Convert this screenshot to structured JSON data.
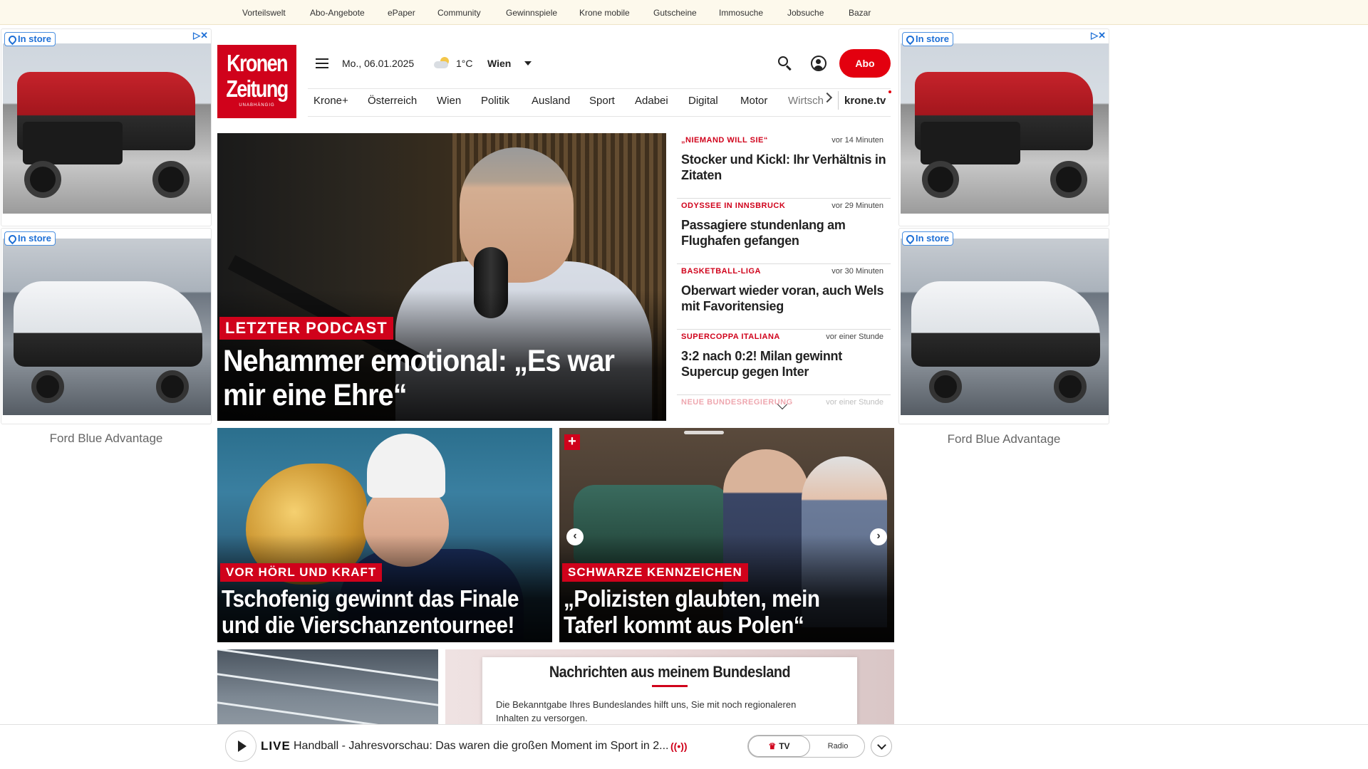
{
  "topbar": {
    "links": [
      "Vorteilswelt",
      "Abo-Angebote",
      "ePaper",
      "Community",
      "Gewinnspiele",
      "Krone mobile",
      "Gutscheine",
      "Immosuche",
      "Jobsuche",
      "Bazar"
    ]
  },
  "ads": {
    "badge": "In store",
    "adchoices": "▷✕",
    "caption": "Ford Blue Advantage"
  },
  "logo": {
    "line1": "Kronen",
    "line2": "Zeitung",
    "line3": "UNABHÄNGIG"
  },
  "header": {
    "date": "Mo., 06.01.2025",
    "temperature": "1°C",
    "city": "Wien",
    "abo_label": "Abo"
  },
  "nav": {
    "items": [
      "Krone+",
      "Österreich",
      "Wien",
      "Politik",
      "Ausland",
      "Sport",
      "Adabei",
      "Digital",
      "Motor",
      "Wirtsch"
    ],
    "tv": "krone.tv"
  },
  "hero": {
    "kicker": "LETZTER PODCAST",
    "title": "Nehammer emotional: „Es war mir eine Ehre“"
  },
  "ticker": [
    {
      "kicker": "„NIEMAND WILL SIE“",
      "time": "vor 14 Minuten",
      "title": "Stocker und Kickl: Ihr Verhältnis in Zitaten"
    },
    {
      "kicker": "ODYSSEE IN INNSBRUCK",
      "time": "vor 29 Minuten",
      "title": "Passagiere stundenlang am Flughafen gefangen"
    },
    {
      "kicker": "BASKETBALL-LIGA",
      "time": "vor 30 Minuten",
      "title": "Oberwart wieder voran, auch Wels mit Favoritensieg"
    },
    {
      "kicker": "SUPERCOPPA ITALIANA",
      "time": "vor einer Stunde",
      "title": "3:2 nach 0:2! Milan gewinnt Supercup gegen Inter"
    },
    {
      "kicker": "NEUE BUNDESREGIERUNG",
      "time": "vor einer Stunde",
      "title": ""
    }
  ],
  "cards": [
    {
      "kicker": "VOR HÖRL UND KRAFT",
      "title": "Tschofenig gewinnt das Finale und die Vierschanzentournee!"
    },
    {
      "kicker": "SCHWARZE KENNZEICHEN",
      "title": "„Polizisten glaubten, mein Taferl kommt aus Polen“"
    }
  ],
  "card_plus": "+",
  "bundesland": {
    "title": "Nachrichten aus meinem Bundesland",
    "text": "Die Bekanntgabe Ihres Bundeslandes hilft uns, Sie mit noch regionaleren Inhalten zu versorgen."
  },
  "player": {
    "live_label": "LIVE",
    "title": "Handball - Jahresvorschau: Das waren die großen Moment im Sport in 2...",
    "tv_label": "TV",
    "radio_label": "Radio"
  },
  "colors": {
    "brand_red": "#d0021b",
    "abo_red": "#e3000f",
    "topbar_bg": "#fdf9ec",
    "link_blue": "#1d6fd6"
  }
}
